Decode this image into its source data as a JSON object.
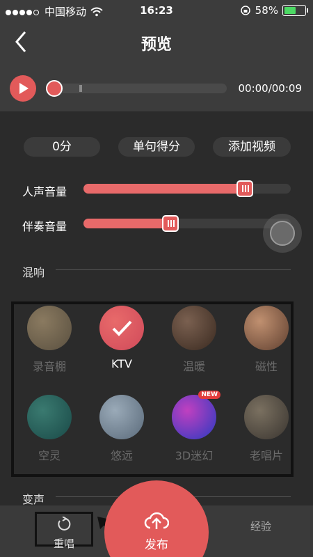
{
  "status_bar": {
    "carrier": "中国移动",
    "time": "16:23",
    "battery_percent": "58%",
    "battery_level": 0.58
  },
  "nav": {
    "title": "预览",
    "back_icon": "back-chevron-icon"
  },
  "player": {
    "time_display": "00:00/00:09",
    "progress": 0.0
  },
  "score_row": {
    "score": "0分",
    "sentence_score": "单句得分",
    "add_video": "添加视频"
  },
  "sliders": [
    {
      "label": "人声音量",
      "value": 0.78
    },
    {
      "label": "伴奏音量",
      "value": 0.42
    }
  ],
  "reverb": {
    "title": "混响",
    "effects": [
      {
        "name": "录音棚",
        "selected": false,
        "colors": [
          "#5a5040",
          "#8a7a60"
        ]
      },
      {
        "name": "KTV",
        "selected": true,
        "colors": [
          "#d04a5a",
          "#e86a6a"
        ]
      },
      {
        "name": "温暖",
        "selected": false,
        "colors": [
          "#3a2a20",
          "#7a6050"
        ]
      },
      {
        "name": "磁性",
        "selected": false,
        "colors": [
          "#604030",
          "#c09070"
        ]
      },
      {
        "name": "空灵",
        "selected": false,
        "colors": [
          "#1a4a48",
          "#3a7a70"
        ]
      },
      {
        "name": "悠远",
        "selected": false,
        "colors": [
          "#5a6a7a",
          "#9aaab8"
        ]
      },
      {
        "name": "3D迷幻",
        "selected": false,
        "badge": "NEW",
        "colors": [
          "#2a3ac0",
          "#c040c0"
        ]
      },
      {
        "name": "老唱片",
        "selected": false,
        "colors": [
          "#3a3530",
          "#7a7060"
        ]
      }
    ]
  },
  "voice_change": {
    "title": "变声"
  },
  "bottom": {
    "retry_label": "重唱",
    "publish_label": "发布",
    "share_label": "经验"
  }
}
